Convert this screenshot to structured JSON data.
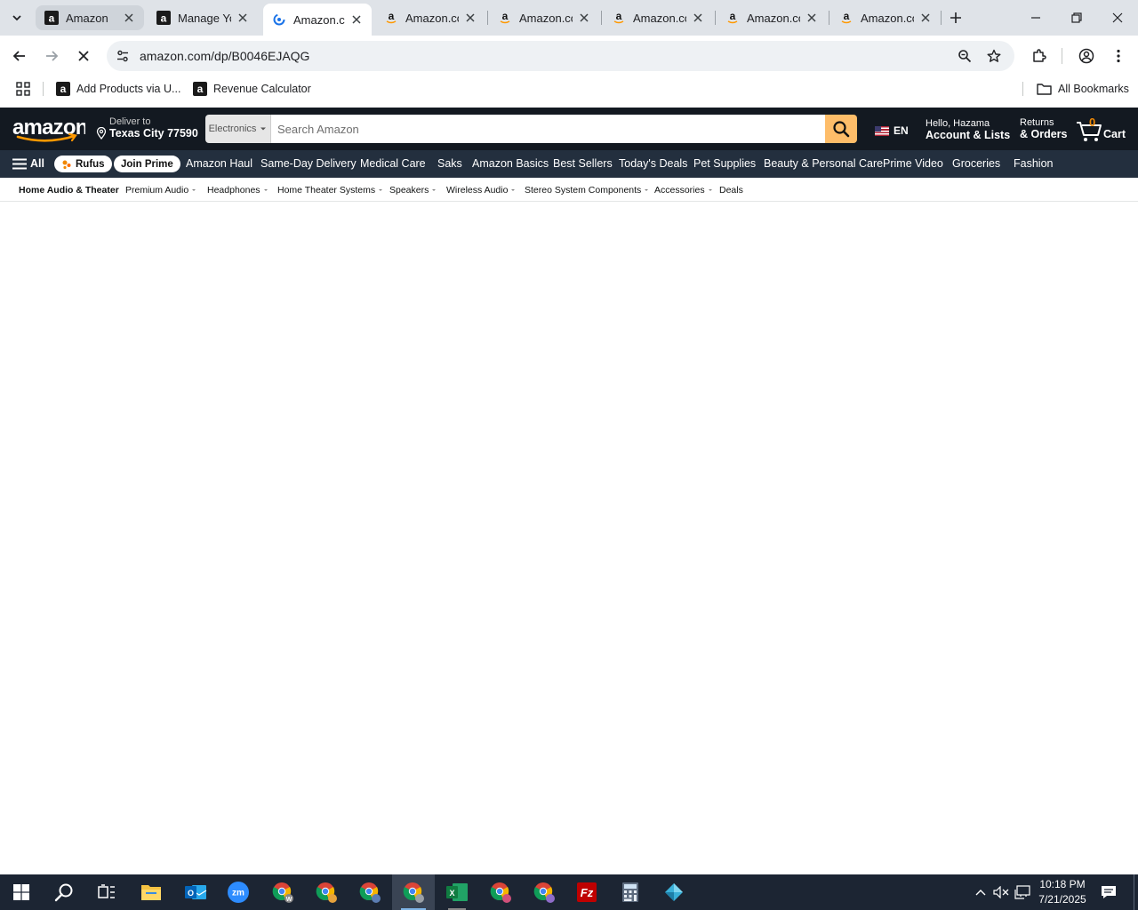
{
  "browser": {
    "tabs": [
      {
        "title": "Amazon",
        "favicon": "amazon-a",
        "state": "grey"
      },
      {
        "title": "Manage Yo",
        "favicon": "amazon-a",
        "state": "normal"
      },
      {
        "title": "Amazon.co",
        "favicon": "loading",
        "state": "active"
      },
      {
        "title": "Amazon.co",
        "favicon": "amazon-smile",
        "state": "normal"
      },
      {
        "title": "Amazon.co",
        "favicon": "amazon-smile",
        "state": "normal"
      },
      {
        "title": "Amazon.co",
        "favicon": "amazon-smile",
        "state": "normal"
      },
      {
        "title": "Amazon.co",
        "favicon": "amazon-smile",
        "state": "normal"
      },
      {
        "title": "Amazon.co",
        "favicon": "amazon-smile",
        "state": "normal"
      }
    ],
    "url": "amazon.com/dp/B0046EJAQG",
    "bookmarks": [
      {
        "label": "Add Products via U..."
      },
      {
        "label": "Revenue Calculator"
      }
    ],
    "all_bookmarks_label": "All Bookmarks"
  },
  "amazon": {
    "deliver_line1": "Deliver to",
    "deliver_line2": "Texas City 77590",
    "search_category": "Electronics",
    "search_placeholder": "Search Amazon",
    "language": "EN",
    "account_line1": "Hello, Hazama",
    "account_line2": "Account & Lists",
    "returns_line1": "Returns",
    "returns_line2": "& Orders",
    "cart_count": "0",
    "cart_label": "Cart",
    "nav": {
      "all_label": "All",
      "rufus_label": "Rufus",
      "join_prime_label": "Join Prime",
      "items": [
        "Amazon Haul",
        "Same-Day Delivery",
        "Medical Care",
        "Saks",
        "Amazon Basics",
        "Best Sellers",
        "Today's Deals",
        "Pet Supplies",
        "Beauty & Personal Care",
        "Prime Video",
        "Groceries",
        "Fashion"
      ]
    },
    "subnav": {
      "title": "Home Audio & Theater",
      "items": [
        "Premium Audio",
        "Headphones",
        "Home Theater Systems",
        "Speakers",
        "Wireless Audio",
        "Stereo System Components",
        "Accessories",
        "Deals"
      ]
    }
  },
  "taskbar": {
    "time": "10:18 PM",
    "date": "7/21/2025"
  },
  "colors": {
    "amazon_dark": "#131921",
    "amazon_nav": "#232f3e",
    "amazon_orange": "#febd69",
    "cart_count": "#f08804",
    "tabstrip": "#dfe3e8"
  }
}
